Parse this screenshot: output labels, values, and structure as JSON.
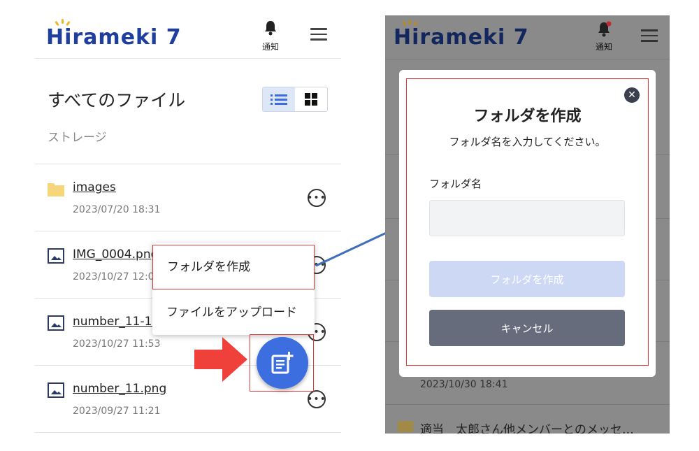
{
  "left": {
    "logo": "Hirameki 7",
    "notification_label": "通知",
    "page_title": "すべてのファイル",
    "storage_label": "ストレージ",
    "files": [
      {
        "name": "images",
        "date": "2023/07/20 18:31",
        "icon": "folder-icon"
      },
      {
        "name": "IMG_0004.png",
        "date": "2023/10/27 12:0",
        "icon": "image-icon"
      },
      {
        "name": "number_11-1.",
        "date": "2023/10/27 11:53",
        "icon": "image-icon"
      },
      {
        "name": "number_11.png",
        "date": "2023/09/27 11:21",
        "icon": "image-icon"
      }
    ],
    "menu": {
      "create_folder": "フォルダを作成",
      "upload_file": "ファイルをアップロード"
    }
  },
  "right": {
    "logo": "Hirameki 7",
    "notification_label": "通知",
    "background_date": "2023/10/30 18:41",
    "background_text": "適当　太郎さん他メンバーとのメッセ…",
    "dialog": {
      "title": "フォルダを作成",
      "subtitle": "フォルダ名を入力してください。",
      "field_label": "フォルダ名",
      "field_value": "",
      "create_button": "フォルダを作成",
      "cancel_button": "キャンセル"
    }
  },
  "colors": {
    "brand": "#1f3f9e",
    "accent": "#3d6ee0",
    "highlight": "#d93a3a",
    "arrow_red": "#f0403a",
    "connector_blue": "#3f6fb8"
  }
}
